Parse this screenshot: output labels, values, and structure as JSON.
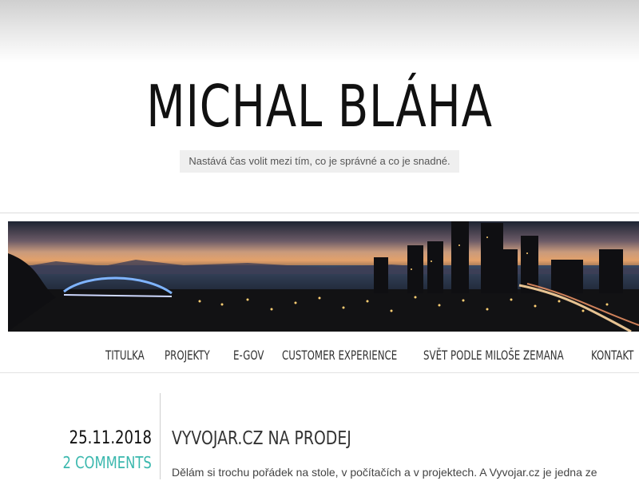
{
  "site": {
    "title": "MICHAL BLÁHA",
    "tagline": "Nastává čas volit mezi tím, co je správné a co je snadné."
  },
  "banner": {
    "icon": "seattle-skyline-photo"
  },
  "nav": {
    "items": [
      {
        "label": "TITULKA"
      },
      {
        "label": "PROJEKTY"
      },
      {
        "label": "E-GOV"
      },
      {
        "label": "CUSTOMER EXPERIENCE"
      },
      {
        "label": "SVĚT PODLE MILOŠE ZEMANA"
      },
      {
        "label": "KONTAKT"
      }
    ]
  },
  "post": {
    "date": "25.11.2018",
    "comments": "2 COMMENTS",
    "title": "VYVOJAR.CZ NA PRODEJ",
    "excerpt": "Dělám si trochu pořádek na stole, v počítačích a v projektech. A Vyvojar.cz je jedna ze"
  },
  "colors": {
    "accent": "#3bb8ae",
    "text": "#333333"
  }
}
